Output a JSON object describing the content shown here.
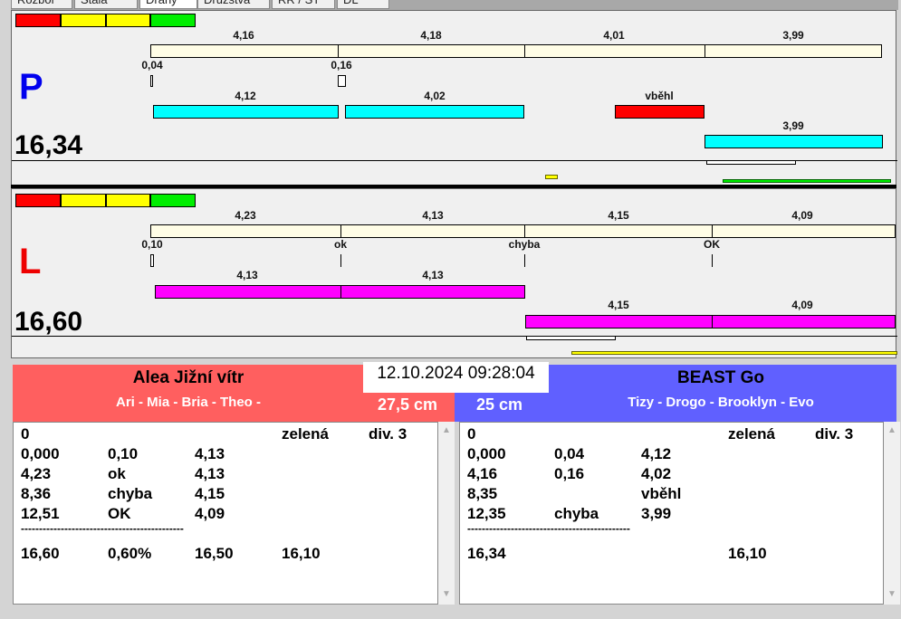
{
  "tabs": [
    "Rozbor",
    "Stala",
    "Dráhy",
    "Družstva",
    "RR / ST",
    "DL"
  ],
  "colors": {
    "red": "#ff0000",
    "yellow": "#ffff00",
    "green": "#00ee00",
    "cyan": "#00ffff",
    "magenta": "#ff00ff",
    "left_header": "#ff5f5f",
    "right_header": "#6060ff",
    "track": "#fffde6"
  },
  "lane_p": {
    "letter": "P",
    "total": "16,34",
    "splits": [
      "4,16",
      "4,18",
      "4,01",
      "3,99"
    ],
    "reactions": [
      "0,04",
      "0,16"
    ],
    "dog_times": [
      "4,12",
      "4,02",
      "vběhl",
      "3,99"
    ]
  },
  "lane_l": {
    "letter": "L",
    "total": "16,60",
    "splits": [
      "4,23",
      "4,13",
      "4,15",
      "4,09"
    ],
    "reactions": [
      "0,10",
      "ok",
      "chyba",
      "OK"
    ],
    "dog_times": [
      "4,13",
      "4,13",
      "4,15",
      "4,09"
    ]
  },
  "datetime": "12.10.2024 09:28:04",
  "left_team": {
    "name": "Alea Jižní vítr",
    "members": "Ari - Mia - Bria - Theo -",
    "height": "27,5 cm",
    "rows": [
      [
        "0",
        "",
        "",
        "zelená",
        "div. 3"
      ],
      [
        "0,000",
        "0,10",
        "4,13",
        "",
        ""
      ],
      [
        "4,23",
        "ok",
        "4,13",
        "",
        ""
      ],
      [
        "8,36",
        "chyba",
        "4,15",
        "",
        ""
      ],
      [
        "12,51",
        "OK",
        "4,09",
        "",
        ""
      ]
    ],
    "separator": "---------------------------------------------",
    "summary": [
      "16,60",
      "0,60%",
      "16,50",
      "16,10",
      ""
    ]
  },
  "right_team": {
    "name": "BEAST Go",
    "members": "Tizy - Drogo - Brooklyn - Evo",
    "height": "25 cm",
    "rows": [
      [
        "0",
        "",
        "",
        "zelená",
        "div. 3"
      ],
      [
        "0,000",
        "0,04",
        "4,12",
        "",
        ""
      ],
      [
        "4,16",
        "0,16",
        "4,02",
        "",
        ""
      ],
      [
        "8,35",
        "",
        "vběhl",
        "",
        ""
      ],
      [
        "12,35",
        "chyba",
        "3,99",
        "",
        ""
      ]
    ],
    "separator": "---------------------------------------------",
    "summary": [
      "16,34",
      "",
      "",
      "16,10",
      ""
    ]
  }
}
